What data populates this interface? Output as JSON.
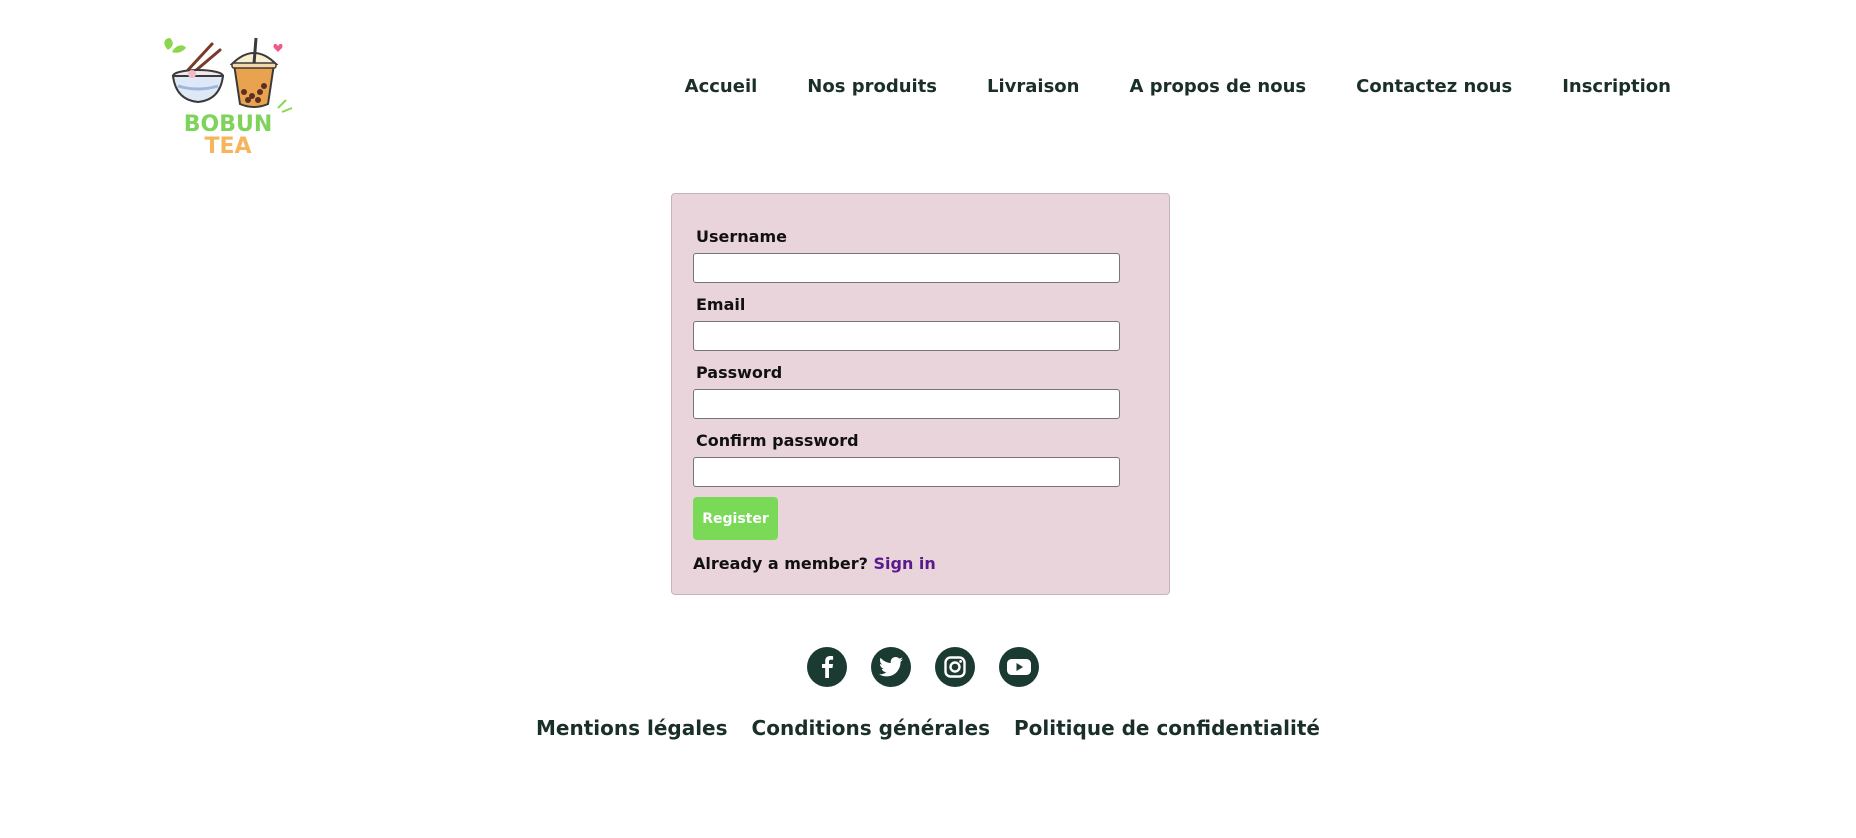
{
  "brand": {
    "line1": "BOBUN",
    "line2": "TEA"
  },
  "nav": {
    "items": [
      {
        "label": "Accueil"
      },
      {
        "label": "Nos produits"
      },
      {
        "label": "Livraison"
      },
      {
        "label": "A propos de nous"
      },
      {
        "label": "Contactez nous"
      },
      {
        "label": "Inscription"
      }
    ]
  },
  "form": {
    "username_label": "Username",
    "username_value": "",
    "email_label": "Email",
    "email_value": "",
    "password_label": "Password",
    "password_value": "",
    "confirm_label": "Confirm password",
    "confirm_value": "",
    "register_label": "Register",
    "member_text": "Already a member?",
    "signin_label": "Sign in"
  },
  "footer": {
    "socials": [
      {
        "icon": "facebook-icon"
      },
      {
        "icon": "twitter-icon"
      },
      {
        "icon": "instagram-icon"
      },
      {
        "icon": "youtube-icon"
      }
    ],
    "links": [
      {
        "label": "Mentions légales"
      },
      {
        "label": "Conditions générales"
      },
      {
        "label": "Politique de confidentialité"
      }
    ]
  },
  "colors": {
    "text_dark": "#1b2f2a",
    "card_bg": "#e9d4dc",
    "register_bg": "#7bd958",
    "signin_link": "#5b1a8c",
    "social_bg": "#1b3a31",
    "logo_green": "#7ed35b",
    "logo_orange": "#f6b45c"
  }
}
